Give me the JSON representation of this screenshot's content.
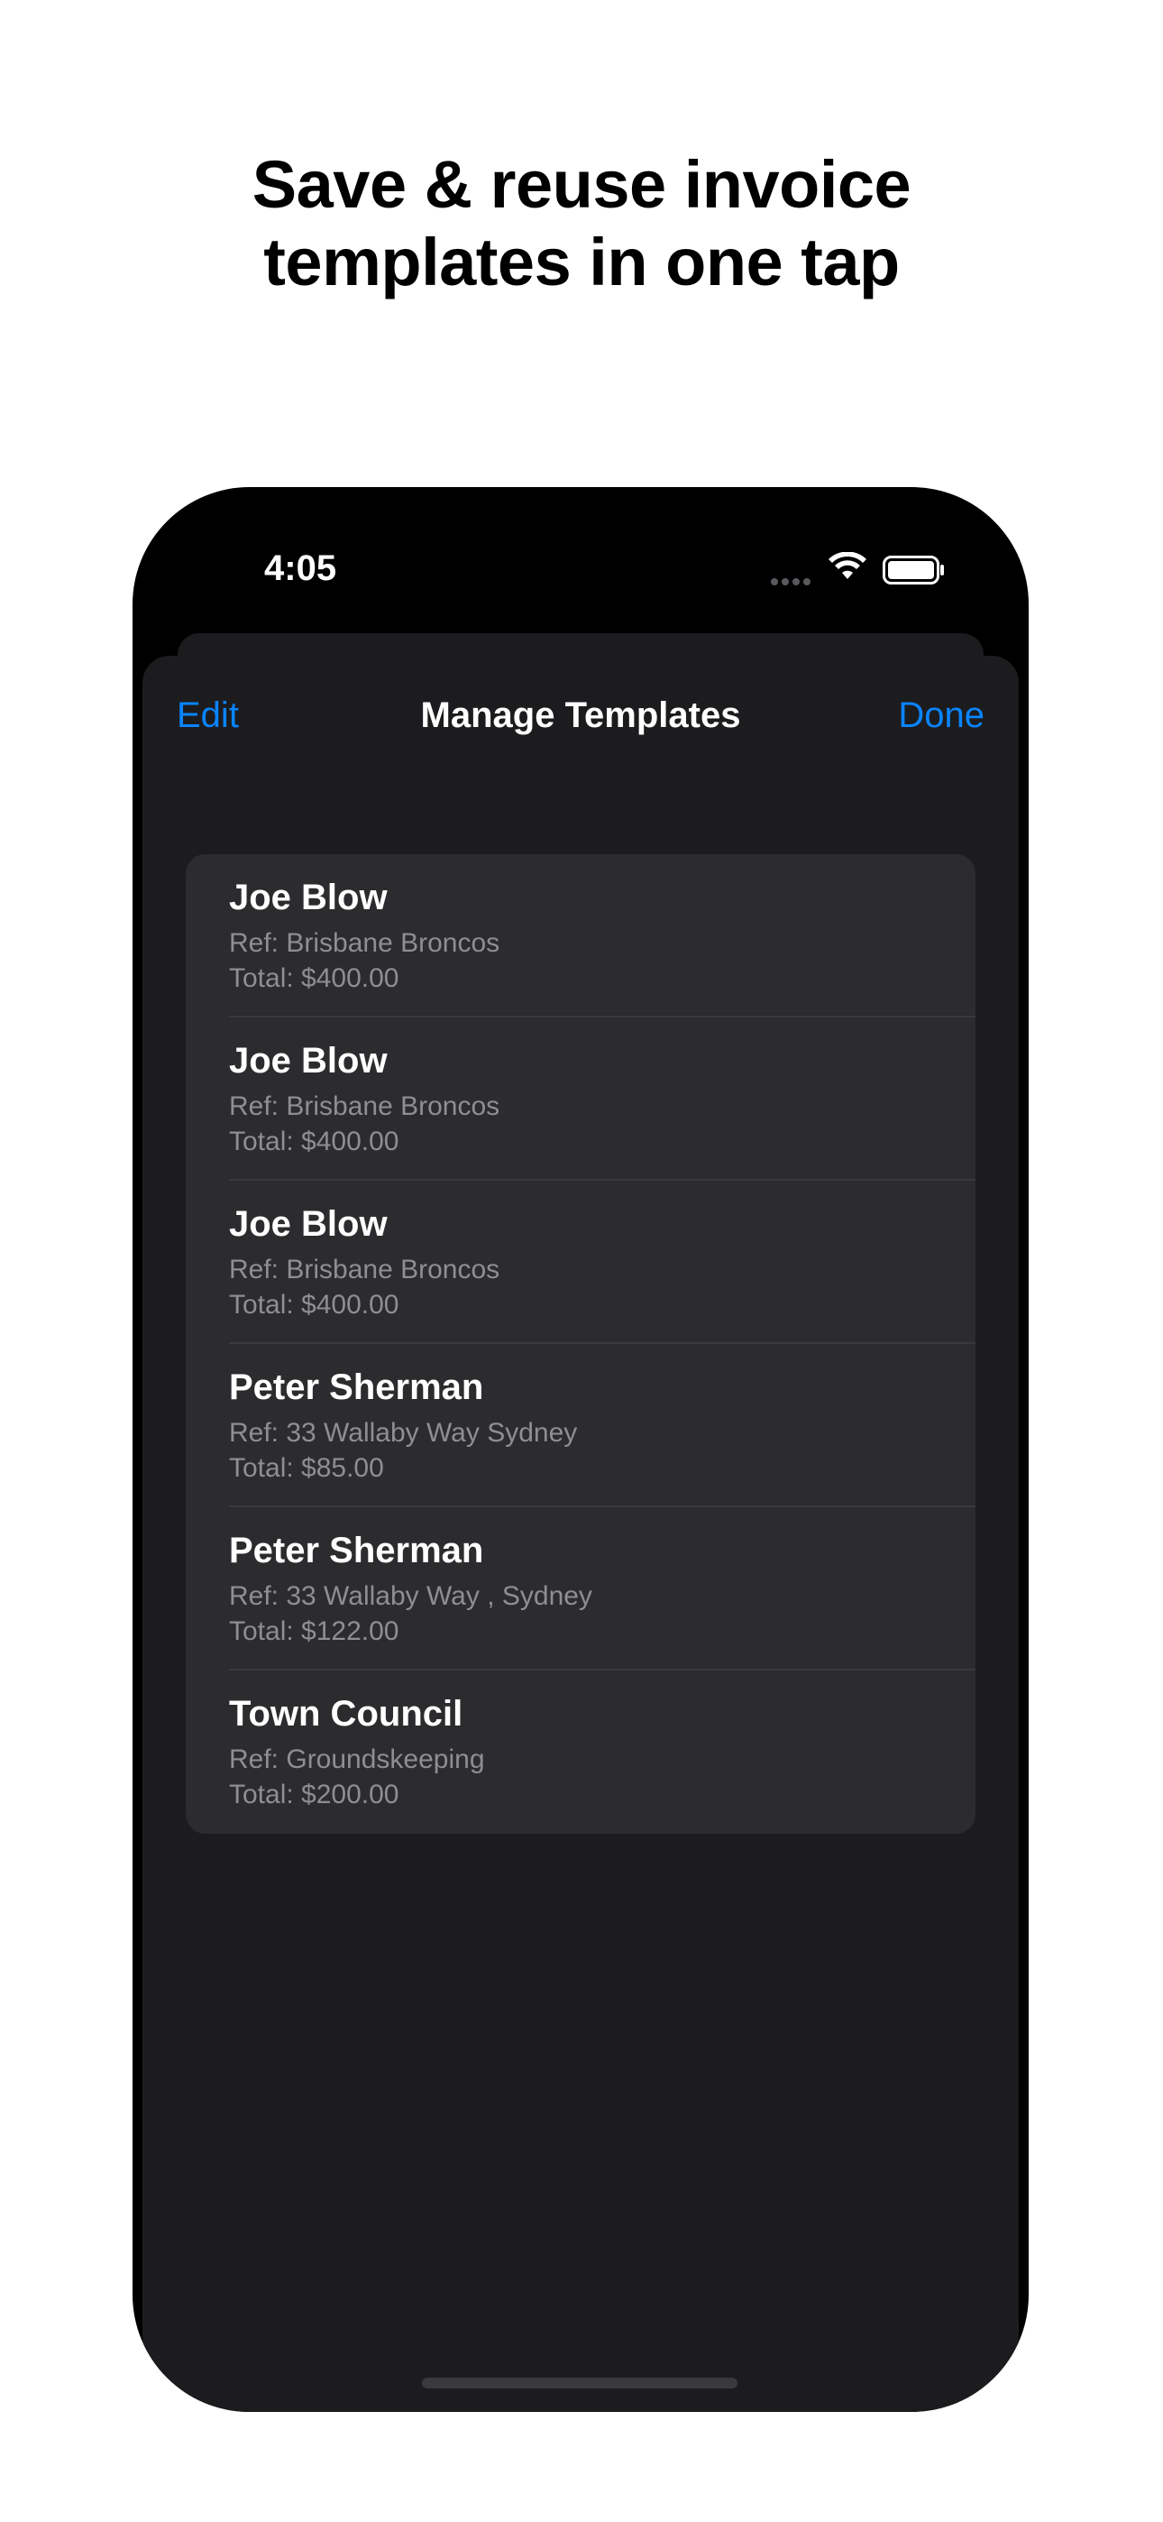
{
  "headline": {
    "line1": "Save & reuse invoice",
    "line2": "templates in one tap"
  },
  "status_bar": {
    "time": "4:05",
    "icons": [
      "signal-icon",
      "wifi-icon",
      "battery-icon"
    ]
  },
  "nav": {
    "edit_label": "Edit",
    "title": "Manage Templates",
    "done_label": "Done"
  },
  "templates": [
    {
      "name": "Joe Blow",
      "ref": "Ref: Brisbane Broncos",
      "total": "Total: $400.00"
    },
    {
      "name": "Joe Blow",
      "ref": "Ref: Brisbane Broncos",
      "total": "Total: $400.00"
    },
    {
      "name": "Joe Blow",
      "ref": "Ref: Brisbane Broncos",
      "total": "Total: $400.00"
    },
    {
      "name": "Peter Sherman",
      "ref": "Ref: 33 Wallaby Way Sydney",
      "total": "Total: $85.00"
    },
    {
      "name": "Peter Sherman",
      "ref": "Ref: 33 Wallaby Way , Sydney",
      "total": "Total: $122.00"
    },
    {
      "name": "Town Council",
      "ref": "Ref: Groundskeeping",
      "total": "Total: $200.00"
    }
  ],
  "colors": {
    "accent": "#0a84ff",
    "sheet_background": "#1c1c1e",
    "list_background": "#2c2c2e",
    "secondary_text": "#8e8e93"
  }
}
